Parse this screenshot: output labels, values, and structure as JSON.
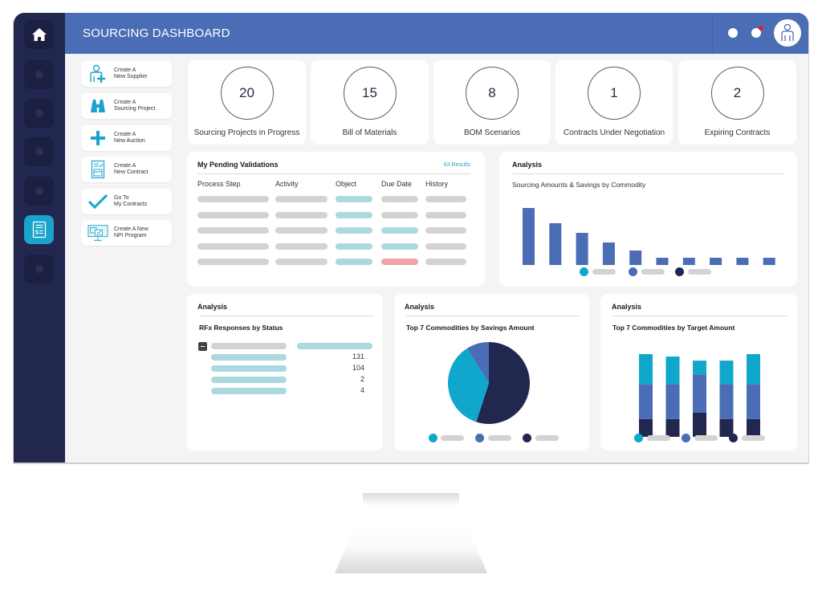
{
  "header": {
    "title": "SOURCING DASHBOARD"
  },
  "sidebar": {
    "items": [
      {
        "icon": "home-icon",
        "active": false
      },
      {
        "icon": "placeholder-icon",
        "active": false
      },
      {
        "icon": "placeholder-icon",
        "active": false
      },
      {
        "icon": "placeholder-icon",
        "active": false
      },
      {
        "icon": "placeholder-icon",
        "active": false
      },
      {
        "icon": "invoice-icon",
        "active": true
      },
      {
        "icon": "placeholder-icon",
        "active": false
      }
    ]
  },
  "quick_actions": [
    {
      "line1": "Create A",
      "line2": "New Supplier",
      "icon": "add-user-icon"
    },
    {
      "line1": "Create A",
      "line2": "Sourcing Project",
      "icon": "binoculars-icon"
    },
    {
      "line1": "Create A",
      "line2": "New Auction",
      "icon": "plus-icon"
    },
    {
      "line1": "Create A",
      "line2": "New Contract",
      "icon": "contract-icon"
    },
    {
      "line1": "Go To",
      "line2": "My Contracts",
      "icon": "checkmark-icon"
    },
    {
      "line1": "Create A New",
      "line2": "NPI Program",
      "icon": "monitor-icon"
    }
  ],
  "kpis": [
    {
      "value": "20",
      "label": "Sourcing Projects in Progress"
    },
    {
      "value": "15",
      "label": "Bill of Materials"
    },
    {
      "value": "8",
      "label": "BOM Scenarios"
    },
    {
      "value": "1",
      "label": "Contracts Under Negotiation"
    },
    {
      "value": "2",
      "label": "Expiring Contracts"
    }
  ],
  "pending": {
    "title": "My Pending Validations",
    "results": "63 Results",
    "columns": [
      "Process Step",
      "Activity",
      "Object",
      "Due Date",
      "History"
    ],
    "rows": [
      [
        "grey",
        "grey",
        "cyan",
        "grey",
        "grey"
      ],
      [
        "grey",
        "grey",
        "cyan",
        "grey",
        "grey"
      ],
      [
        "grey",
        "grey",
        "cyan",
        "cyan",
        "grey"
      ],
      [
        "grey",
        "grey",
        "cyan",
        "cyan",
        "grey"
      ],
      [
        "grey",
        "grey",
        "cyan",
        "red",
        "grey"
      ]
    ]
  },
  "analysis_sourcing": {
    "title": "Analysis",
    "subtitle": "Sourcing Amounts & Savings by Commodity"
  },
  "analysis_rfx": {
    "title": "Analysis",
    "subtitle": "RFx Responses by Status",
    "values": [
      "131",
      "104",
      "2",
      "4"
    ]
  },
  "analysis_savings": {
    "title": "Analysis",
    "subtitle": "Top 7 Commodities by Savings Amount"
  },
  "analysis_target": {
    "title": "Analysis",
    "subtitle": "Top 7 Commodities by Target Amount"
  },
  "colors": {
    "header": "#4a6db5",
    "sidebar": "#222750",
    "accent": "#1aa3cc",
    "series_cyan": "#0fa8cc",
    "series_blue": "#4a6db5",
    "series_navy": "#222750",
    "alert_red": "#e21d2b"
  },
  "chart_data": [
    {
      "type": "bar",
      "title": "Sourcing Amounts & Savings by Commodity",
      "categories": [
        "",
        "",
        "",
        "",
        "",
        "",
        "",
        "",
        "",
        ""
      ],
      "values": [
        71,
        52,
        40,
        28,
        18,
        9,
        9,
        9,
        9,
        9
      ],
      "ylim": [
        0,
        75
      ],
      "grid": false,
      "legend": {
        "position": "bottom",
        "entries": [
          "",
          "",
          ""
        ],
        "colors": [
          "#0fa8cc",
          "#4a6db5",
          "#222750"
        ]
      }
    },
    {
      "type": "pie",
      "title": "Top 7 Commodities by Savings Amount",
      "series": [
        {
          "name": "",
          "value": 55,
          "color": "#222750"
        },
        {
          "name": "",
          "value": 36,
          "color": "#0fa8cc"
        },
        {
          "name": "",
          "value": 9,
          "color": "#4a6db5"
        }
      ],
      "legend": {
        "position": "bottom",
        "colors": [
          "#0fa8cc",
          "#4a6db5",
          "#222750"
        ]
      }
    },
    {
      "type": "bar",
      "stacked": true,
      "title": "Top 7 Commodities by Target Amount",
      "categories": [
        "",
        "",
        "",
        "",
        ""
      ],
      "series": [
        {
          "name": "",
          "color": "#222750",
          "values": [
            22,
            22,
            30,
            22,
            22
          ]
        },
        {
          "name": "",
          "color": "#4a6db5",
          "values": [
            43,
            43,
            47,
            43,
            43
          ]
        },
        {
          "name": "",
          "color": "#0fa8cc",
          "values": [
            37,
            34,
            17,
            29,
            37
          ]
        }
      ],
      "ylim": [
        0,
        102
      ],
      "grid": false,
      "legend": {
        "position": "bottom",
        "colors": [
          "#0fa8cc",
          "#4a6db5",
          "#222750"
        ]
      }
    }
  ]
}
